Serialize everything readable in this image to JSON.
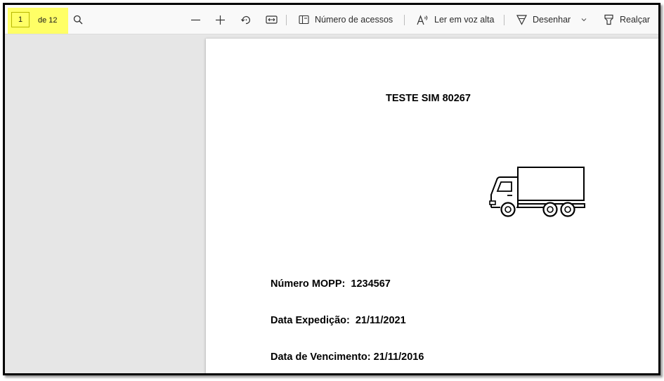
{
  "toolbar": {
    "page_current": "1",
    "page_total": "de 12",
    "accessibility_label": "Número de acessos",
    "read_aloud_label": "Ler em voz alta",
    "draw_label": "Desenhar",
    "highlight_label": "Realçar",
    "highlight_color": "#ffff66"
  },
  "document": {
    "title": "TESTE SIM 80267",
    "fields": [
      {
        "label": "Número MOPP:",
        "value": "1234567"
      },
      {
        "label": "Data Expedição:",
        "value": "21/11/2021"
      },
      {
        "label": "Data de Vencimento:",
        "value": "21/11/2016"
      }
    ]
  }
}
